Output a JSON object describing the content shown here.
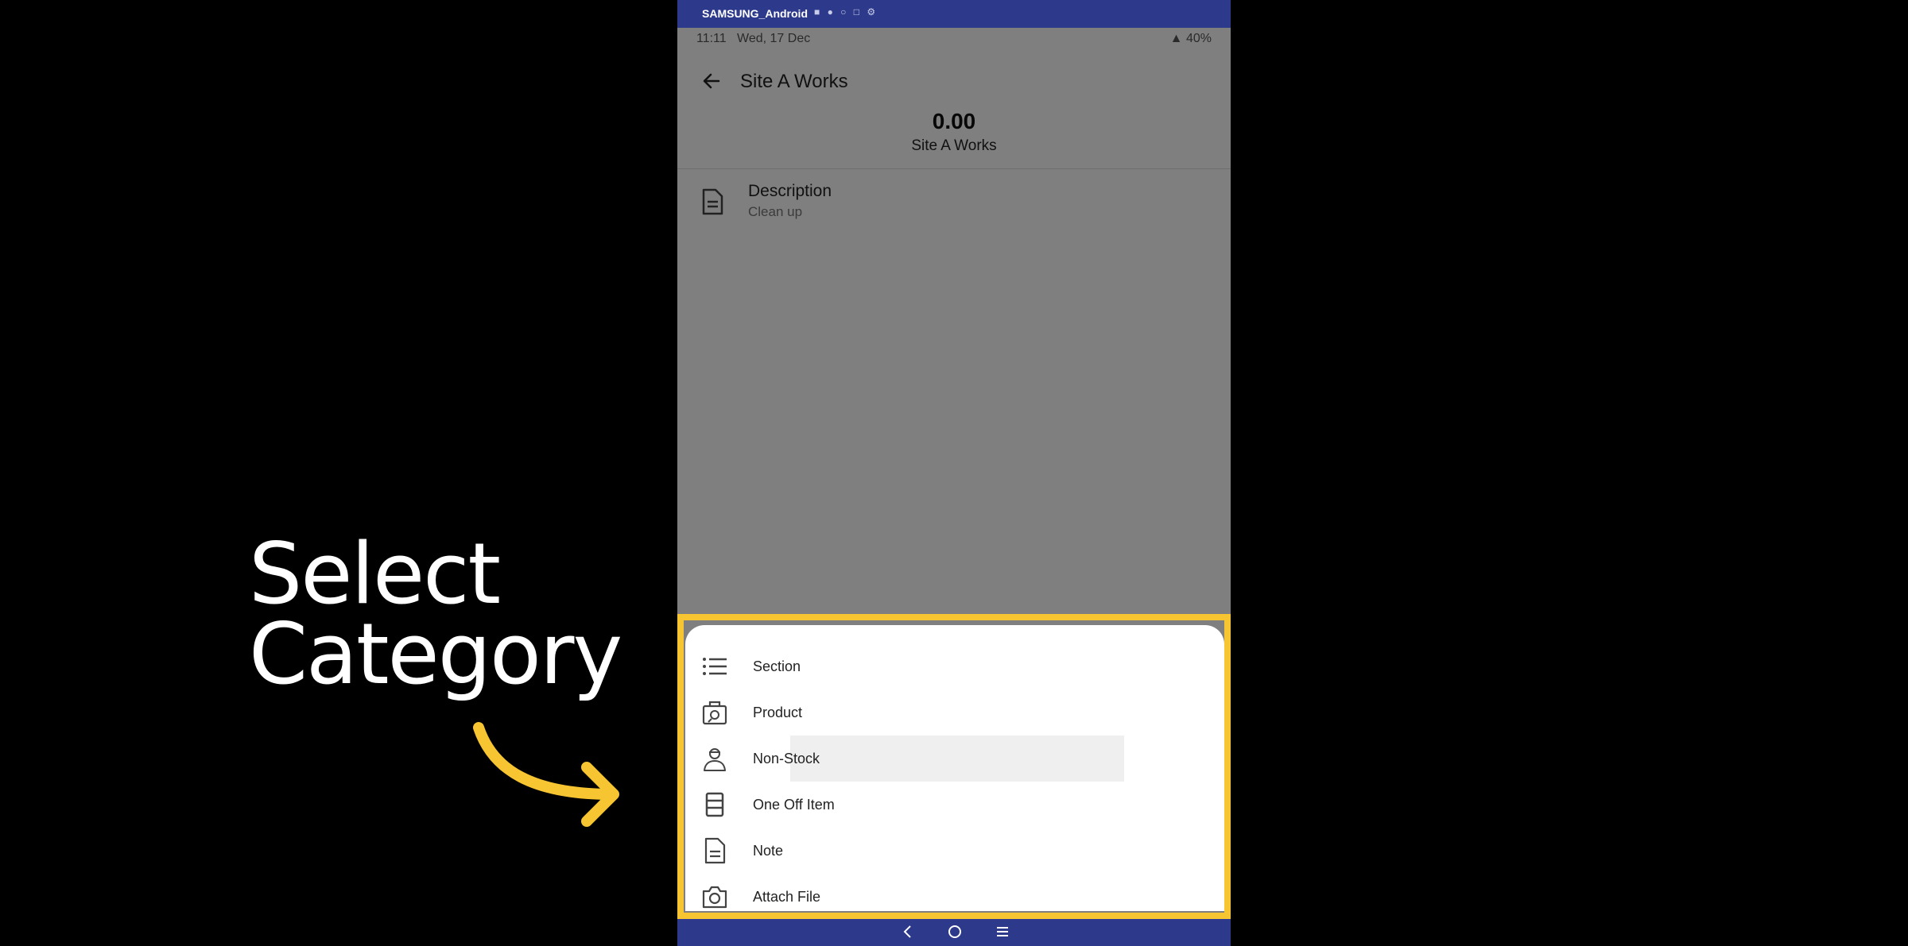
{
  "caption": {
    "line1": "Select",
    "line2": "Category"
  },
  "device": {
    "name": "SAMSUNG_Android"
  },
  "status_bar": {
    "time": "11:11",
    "date": "Wed, 17 Dec",
    "battery": "40%"
  },
  "app_bar": {
    "title": "Site A Works"
  },
  "summary": {
    "amount": "0.00",
    "name": "Site A Works"
  },
  "description": {
    "label": "Description",
    "value": "Clean up"
  },
  "sheet": {
    "items": [
      {
        "label": "Section",
        "icon": "list-icon"
      },
      {
        "label": "Product",
        "icon": "product-box-icon"
      },
      {
        "label": "Non-Stock",
        "icon": "worker-icon",
        "highlighted": true
      },
      {
        "label": "One Off Item",
        "icon": "layers-icon"
      },
      {
        "label": "Note",
        "icon": "note-icon"
      },
      {
        "label": "Attach File",
        "icon": "camera-icon"
      }
    ]
  },
  "colors": {
    "accent_highlight": "#f7c531",
    "device_bar": "#2d3a8c",
    "background": "#000000"
  }
}
